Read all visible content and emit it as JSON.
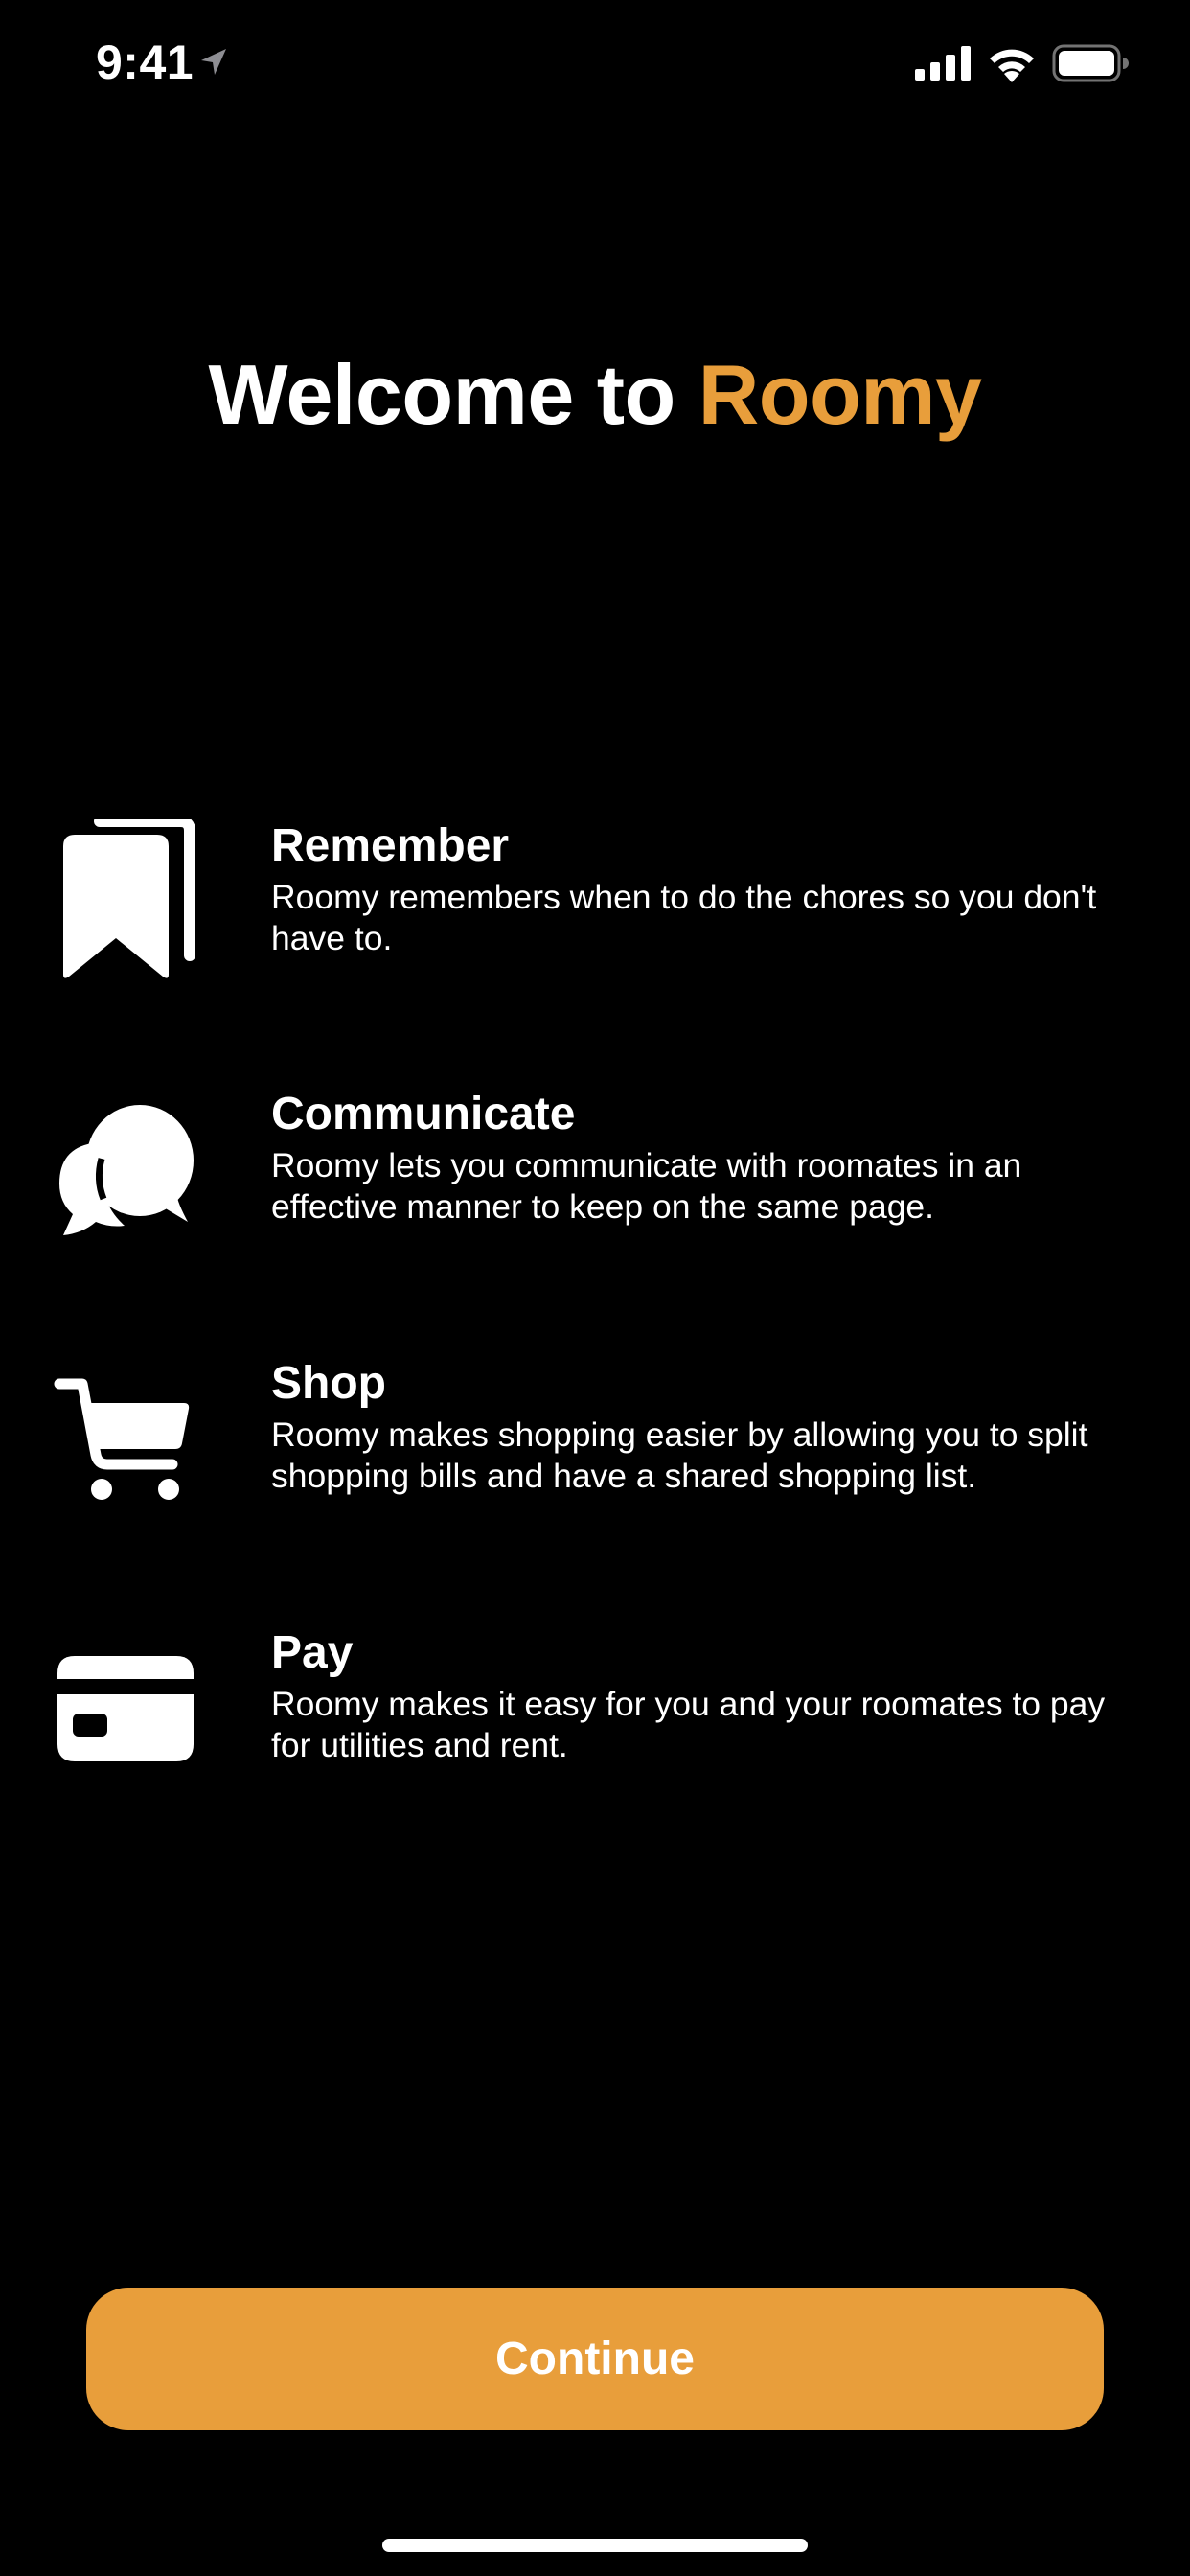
{
  "status_bar": {
    "time": "9:41"
  },
  "welcome": {
    "title_prefix": "Welcome to ",
    "title_brand": "Roomy"
  },
  "features": [
    {
      "icon": "bookmarks-icon",
      "title": "Remember",
      "description": "Roomy remembers when to do the chores so you don't have to."
    },
    {
      "icon": "chat-bubbles-icon",
      "title": "Communicate",
      "description": "Roomy lets you communicate with roomates in an effective manner to keep on the same page."
    },
    {
      "icon": "cart-icon",
      "title": "Shop",
      "description": "Roomy makes shopping easier by allowing you to split shopping bills and have a shared shopping list."
    },
    {
      "icon": "credit-card-icon",
      "title": "Pay",
      "description": "Roomy makes it easy for you and your roomates to pay for utilities and rent."
    }
  ],
  "continue_label": "Continue",
  "colors": {
    "accent": "#E89E3B",
    "background": "#000000",
    "text": "#FFFFFF"
  }
}
